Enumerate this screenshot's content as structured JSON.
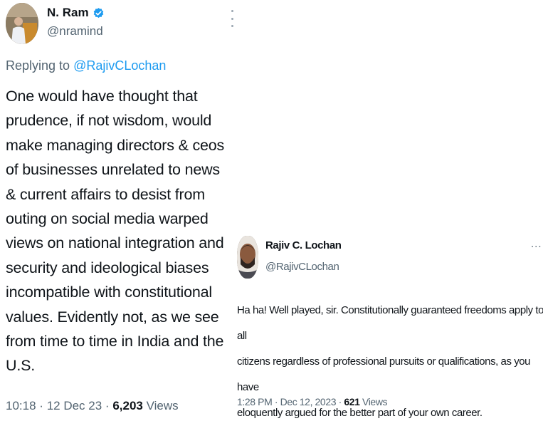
{
  "left_tweet": {
    "author_name": "N. Ram",
    "author_handle": "@nramind",
    "replying_prefix": "Replying to",
    "replying_handle": "@RajivCLochan",
    "text": "One would have thought that\nprudence, if not wisdom, would\nmake managing directors & ceos\nof businesses unrelated to news\n& current affairs to desist from\nouting on social media warped\nviews on national integration and\nsecurity and ideological biases\nincompatible with constitutional\nvalues. Evidently not, as we see\nfrom time to time in India and the\nU.S.",
    "time": "10:18",
    "date": "12 Dec 23",
    "views_count": "6,203",
    "views_label": "Views",
    "separator": "·",
    "icons": {
      "verified": "verified-badge-icon",
      "menu": "more-vertical-icon"
    },
    "colors": {
      "verified": "#1d9bf0",
      "link": "#1d9bf0",
      "muted": "#536471"
    }
  },
  "right_tweet": {
    "author_name": "Rajiv C. Lochan",
    "author_handle": "@RajivCLochan",
    "more_label": "...",
    "text": "Ha ha! Well played, sir. Constitutionally guaranteed freedoms apply to all\ncitizens regardless of professional pursuits or qualifications, as you have\neloquently argued for the better part of your own career.",
    "time": "1:28 PM",
    "date": "Dec 12, 2023",
    "views_count": "621",
    "views_label": "Views",
    "separator": "·",
    "icons": {
      "menu": "more-horizontal-icon"
    }
  }
}
